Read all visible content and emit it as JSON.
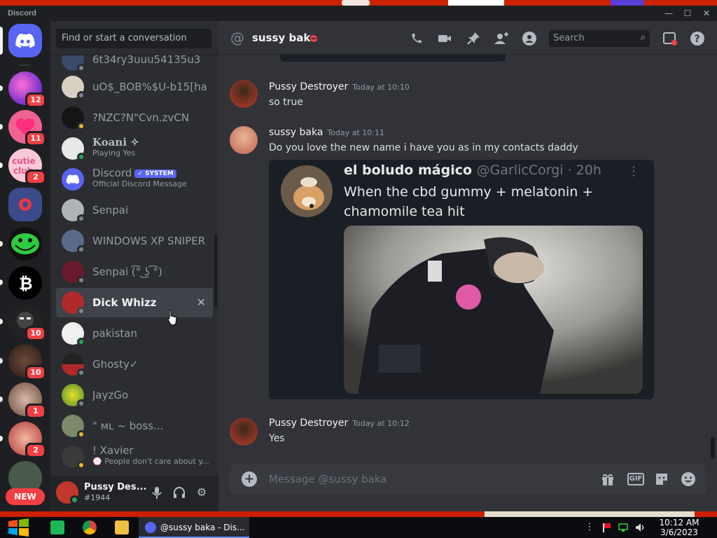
{
  "window": {
    "app_title": "Discord"
  },
  "servers": [
    {
      "name": "discord-home",
      "badge": ""
    },
    {
      "name": "server-1",
      "badge": "12"
    },
    {
      "name": "server-2",
      "badge": "11"
    },
    {
      "name": "server-3",
      "badge": "2"
    },
    {
      "name": "server-4",
      "badge": ""
    },
    {
      "name": "server-5",
      "badge": ""
    },
    {
      "name": "server-6",
      "badge": ""
    },
    {
      "name": "server-7",
      "badge": "10"
    },
    {
      "name": "server-8",
      "badge": "10"
    },
    {
      "name": "server-9",
      "badge": "1"
    },
    {
      "name": "server-10",
      "badge": "2"
    }
  ],
  "new_pill": "NEW",
  "dm": {
    "search_placeholder": "Find or start a conversation",
    "items": [
      {
        "name": "6t34ry3uuu54135u3",
        "sub": "",
        "status": "#80848e"
      },
      {
        "name": "uO$_BOB%$U-b15[ha",
        "sub": "",
        "status": "#80848e"
      },
      {
        "name": "?NZC?N\"Cvn.zvCN",
        "sub": "",
        "status": "#f0b232"
      },
      {
        "name": "Koani ✧",
        "sub": "Playing Yes",
        "status": "#23a55a"
      },
      {
        "name": "Discord",
        "sub": "Official Discord Message",
        "status": "",
        "badge": "✓ SYSTEM"
      },
      {
        "name": "Senpai",
        "sub": "",
        "status": "#80848e"
      },
      {
        "name": "WINDOWS XP SNIPER",
        "sub": "",
        "status": "#80848e"
      },
      {
        "name": "Senpai (͡° ͜ʖ ͡°)",
        "sub": "",
        "status": "#80848e"
      },
      {
        "name": "Dick Whizz",
        "sub": "",
        "status": "#80848e"
      },
      {
        "name": "pakistan",
        "sub": "",
        "status": "#23a55a"
      },
      {
        "name": "Ghosty✓",
        "sub": "",
        "status": "#80848e"
      },
      {
        "name": "JayzGo",
        "sub": "",
        "status": "#80848e"
      },
      {
        "name": "\"    ᴍʟ  ~ boss...",
        "sub": "",
        "status": "#f0b232"
      },
      {
        "name": "! Xavier",
        "sub": "💮 People don't care about y...",
        "status": "#f0b232"
      }
    ],
    "close_glyph": "✕"
  },
  "user": {
    "name": "Pussy Des...",
    "tag": "#1944"
  },
  "chat": {
    "channel_name": "sussy baka",
    "search_placeholder": "Search",
    "messages": [
      {
        "author": "Pussy Destroyer",
        "time": "Today at 10:10",
        "text": "so true"
      },
      {
        "author": "sussy baka",
        "time": "Today at 10:11",
        "text": "Do you love the new name i have you as in my contacts daddy"
      },
      {
        "author": "Pussy Destroyer",
        "time": "Today at 10:12",
        "text": "Yes"
      }
    ],
    "embed": {
      "name": "el boludo mágico",
      "handle": "@GarlicCorgi · 20h",
      "text": "When the cbd gummy + melatonin + chamomile tea hit",
      "more": "⋮"
    },
    "composer_placeholder": "Message @sussy baka",
    "gif_label": "GIF"
  },
  "taskbar": {
    "task_label": "@sussy baka - Dis...",
    "time": "10:12 AM",
    "date": "3/6/2023"
  }
}
